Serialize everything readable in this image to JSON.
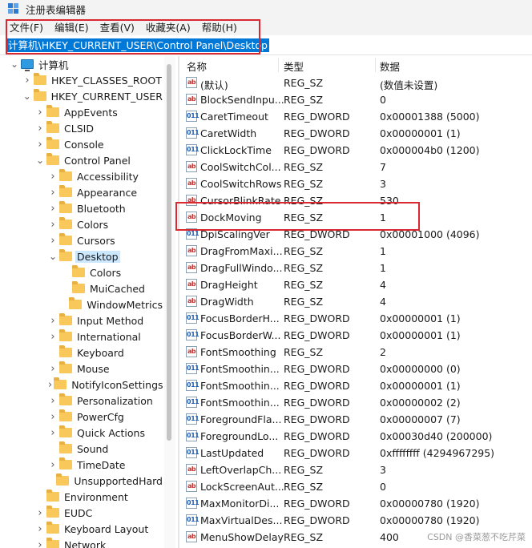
{
  "window": {
    "title": "注册表编辑器"
  },
  "menu": [
    "文件(F)",
    "编辑(E)",
    "查看(V)",
    "收藏夹(A)",
    "帮助(H)"
  ],
  "address": "计算机\\HKEY_CURRENT_USER\\Control Panel\\Desktop",
  "tree": [
    {
      "label": "计算机",
      "indent": 0,
      "icon": "computer-icon",
      "chevron": "down"
    },
    {
      "label": "HKEY_CLASSES_ROOT",
      "indent": 1,
      "icon": "folder-icon",
      "chevron": "right"
    },
    {
      "label": "HKEY_CURRENT_USER",
      "indent": 1,
      "icon": "folder-icon",
      "chevron": "down"
    },
    {
      "label": "AppEvents",
      "indent": 2,
      "icon": "folder-icon",
      "chevron": "right"
    },
    {
      "label": "CLSID",
      "indent": 2,
      "icon": "folder-icon",
      "chevron": "right"
    },
    {
      "label": "Console",
      "indent": 2,
      "icon": "folder-icon",
      "chevron": "right"
    },
    {
      "label": "Control Panel",
      "indent": 2,
      "icon": "folder-icon",
      "chevron": "down"
    },
    {
      "label": "Accessibility",
      "indent": 3,
      "icon": "folder-icon",
      "chevron": "right"
    },
    {
      "label": "Appearance",
      "indent": 3,
      "icon": "folder-icon",
      "chevron": "right"
    },
    {
      "label": "Bluetooth",
      "indent": 3,
      "icon": "folder-icon",
      "chevron": "right"
    },
    {
      "label": "Colors",
      "indent": 3,
      "icon": "folder-icon",
      "chevron": "right"
    },
    {
      "label": "Cursors",
      "indent": 3,
      "icon": "folder-icon",
      "chevron": "right"
    },
    {
      "label": "Desktop",
      "indent": 3,
      "icon": "folder-open-icon",
      "chevron": "down",
      "selected": true
    },
    {
      "label": "Colors",
      "indent": 4,
      "icon": "folder-icon",
      "chevron": ""
    },
    {
      "label": "MuiCached",
      "indent": 4,
      "icon": "folder-icon",
      "chevron": ""
    },
    {
      "label": "WindowMetrics",
      "indent": 4,
      "icon": "folder-icon",
      "chevron": ""
    },
    {
      "label": "Input Method",
      "indent": 3,
      "icon": "folder-icon",
      "chevron": "right"
    },
    {
      "label": "International",
      "indent": 3,
      "icon": "folder-icon",
      "chevron": "right"
    },
    {
      "label": "Keyboard",
      "indent": 3,
      "icon": "folder-icon",
      "chevron": ""
    },
    {
      "label": "Mouse",
      "indent": 3,
      "icon": "folder-icon",
      "chevron": "right"
    },
    {
      "label": "NotifyIconSettings",
      "indent": 3,
      "icon": "folder-icon",
      "chevron": "right"
    },
    {
      "label": "Personalization",
      "indent": 3,
      "icon": "folder-icon",
      "chevron": "right"
    },
    {
      "label": "PowerCfg",
      "indent": 3,
      "icon": "folder-icon",
      "chevron": "right"
    },
    {
      "label": "Quick Actions",
      "indent": 3,
      "icon": "folder-icon",
      "chevron": "right"
    },
    {
      "label": "Sound",
      "indent": 3,
      "icon": "folder-icon",
      "chevron": ""
    },
    {
      "label": "TimeDate",
      "indent": 3,
      "icon": "folder-icon",
      "chevron": "right"
    },
    {
      "label": "UnsupportedHard",
      "indent": 3,
      "icon": "folder-icon",
      "chevron": ""
    },
    {
      "label": "Environment",
      "indent": 2,
      "icon": "folder-icon",
      "chevron": ""
    },
    {
      "label": "EUDC",
      "indent": 2,
      "icon": "folder-icon",
      "chevron": "right"
    },
    {
      "label": "Keyboard Layout",
      "indent": 2,
      "icon": "folder-icon",
      "chevron": "right"
    },
    {
      "label": "Network",
      "indent": 2,
      "icon": "folder-icon",
      "chevron": "right"
    }
  ],
  "columns": {
    "name": "名称",
    "type": "类型",
    "data": "数据"
  },
  "values": [
    {
      "name": "(默认)",
      "type": "REG_SZ",
      "data": "(数值未设置)",
      "kind": "sz"
    },
    {
      "name": "BlockSendInpu...",
      "type": "REG_SZ",
      "data": "0",
      "kind": "sz"
    },
    {
      "name": "CaretTimeout",
      "type": "REG_DWORD",
      "data": "0x00001388 (5000)",
      "kind": "dword"
    },
    {
      "name": "CaretWidth",
      "type": "REG_DWORD",
      "data": "0x00000001 (1)",
      "kind": "dword"
    },
    {
      "name": "ClickLockTime",
      "type": "REG_DWORD",
      "data": "0x000004b0 (1200)",
      "kind": "dword"
    },
    {
      "name": "CoolSwitchCol...",
      "type": "REG_SZ",
      "data": "7",
      "kind": "sz"
    },
    {
      "name": "CoolSwitchRows",
      "type": "REG_SZ",
      "data": "3",
      "kind": "sz"
    },
    {
      "name": "CursorBlinkRate",
      "type": "REG_SZ",
      "data": "530",
      "kind": "sz"
    },
    {
      "name": "DockMoving",
      "type": "REG_SZ",
      "data": "1",
      "kind": "sz"
    },
    {
      "name": "DpiScalingVer",
      "type": "REG_DWORD",
      "data": "0x00001000 (4096)",
      "kind": "dword"
    },
    {
      "name": "DragFromMaxi...",
      "type": "REG_SZ",
      "data": "1",
      "kind": "sz"
    },
    {
      "name": "DragFullWindo...",
      "type": "REG_SZ",
      "data": "1",
      "kind": "sz"
    },
    {
      "name": "DragHeight",
      "type": "REG_SZ",
      "data": "4",
      "kind": "sz"
    },
    {
      "name": "DragWidth",
      "type": "REG_SZ",
      "data": "4",
      "kind": "sz"
    },
    {
      "name": "FocusBorderH...",
      "type": "REG_DWORD",
      "data": "0x00000001 (1)",
      "kind": "dword"
    },
    {
      "name": "FocusBorderW...",
      "type": "REG_DWORD",
      "data": "0x00000001 (1)",
      "kind": "dword"
    },
    {
      "name": "FontSmoothing",
      "type": "REG_SZ",
      "data": "2",
      "kind": "sz"
    },
    {
      "name": "FontSmoothin...",
      "type": "REG_DWORD",
      "data": "0x00000000 (0)",
      "kind": "dword"
    },
    {
      "name": "FontSmoothin...",
      "type": "REG_DWORD",
      "data": "0x00000001 (1)",
      "kind": "dword"
    },
    {
      "name": "FontSmoothin...",
      "type": "REG_DWORD",
      "data": "0x00000002 (2)",
      "kind": "dword"
    },
    {
      "name": "ForegroundFla...",
      "type": "REG_DWORD",
      "data": "0x00000007 (7)",
      "kind": "dword"
    },
    {
      "name": "ForegroundLo...",
      "type": "REG_DWORD",
      "data": "0x00030d40 (200000)",
      "kind": "dword"
    },
    {
      "name": "LastUpdated",
      "type": "REG_DWORD",
      "data": "0xffffffff (4294967295)",
      "kind": "dword"
    },
    {
      "name": "LeftOverlapCh...",
      "type": "REG_SZ",
      "data": "3",
      "kind": "sz"
    },
    {
      "name": "LockScreenAut...",
      "type": "REG_SZ",
      "data": "0",
      "kind": "sz"
    },
    {
      "name": "MaxMonitorDi...",
      "type": "REG_DWORD",
      "data": "0x00000780 (1920)",
      "kind": "dword"
    },
    {
      "name": "MaxVirtualDes...",
      "type": "REG_DWORD",
      "data": "0x00000780 (1920)",
      "kind": "dword"
    },
    {
      "name": "MenuShowDelay",
      "type": "REG_SZ",
      "data": "400",
      "kind": "sz"
    }
  ],
  "watermark": "CSDN @香菜葱不吃芹菜",
  "colors": {
    "highlight": "#0078d7",
    "annotation": "#d9282f",
    "selection": "#cce8ff"
  }
}
